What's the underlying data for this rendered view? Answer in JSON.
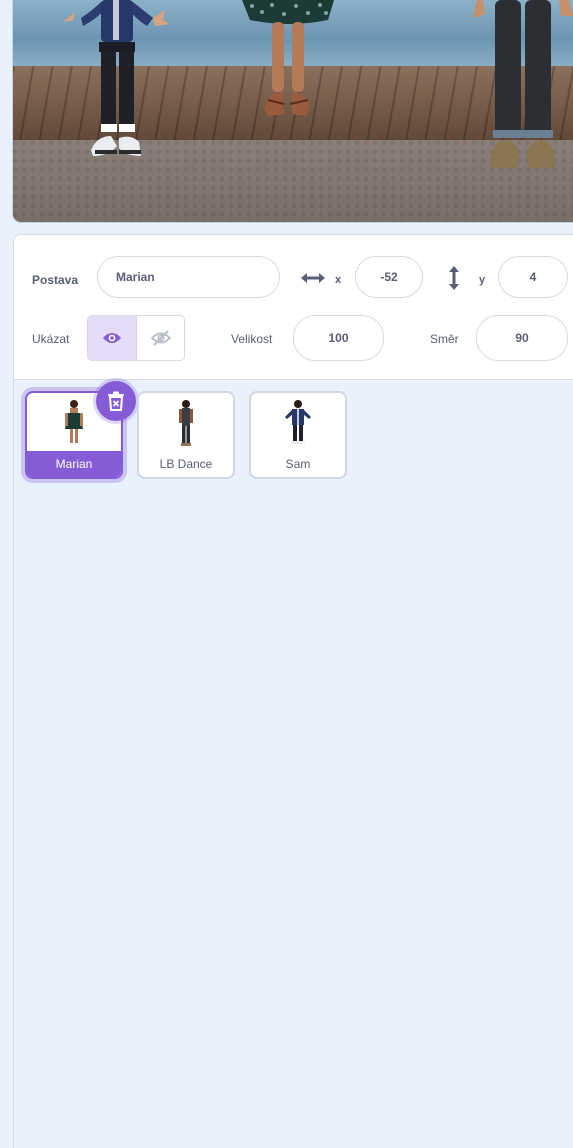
{
  "stage": {
    "scene": "boardwalk-by-the-sea"
  },
  "sprite_info": {
    "sprite_label": "Postava",
    "sprite_name": "Marian",
    "x_label": "x",
    "x_value": "-52",
    "y_label": "y",
    "y_value": "4",
    "show_label": "Ukázat",
    "visible": true,
    "size_label": "Velikost",
    "size_value": "100",
    "direction_label": "Směr",
    "direction_value": "90"
  },
  "sprites": [
    {
      "name": "Marian",
      "selected": true
    },
    {
      "name": "LB Dance",
      "selected": false
    },
    {
      "name": "Sam",
      "selected": false
    }
  ],
  "colors": {
    "accent": "#855cd6",
    "background": "#e9f1fc",
    "text": "#575e75"
  },
  "icons": {
    "x_axis": "horizontal-arrows-icon",
    "y_axis": "vertical-arrows-icon",
    "show": "eye-icon",
    "hide": "eye-slash-icon",
    "delete": "trash-icon"
  }
}
